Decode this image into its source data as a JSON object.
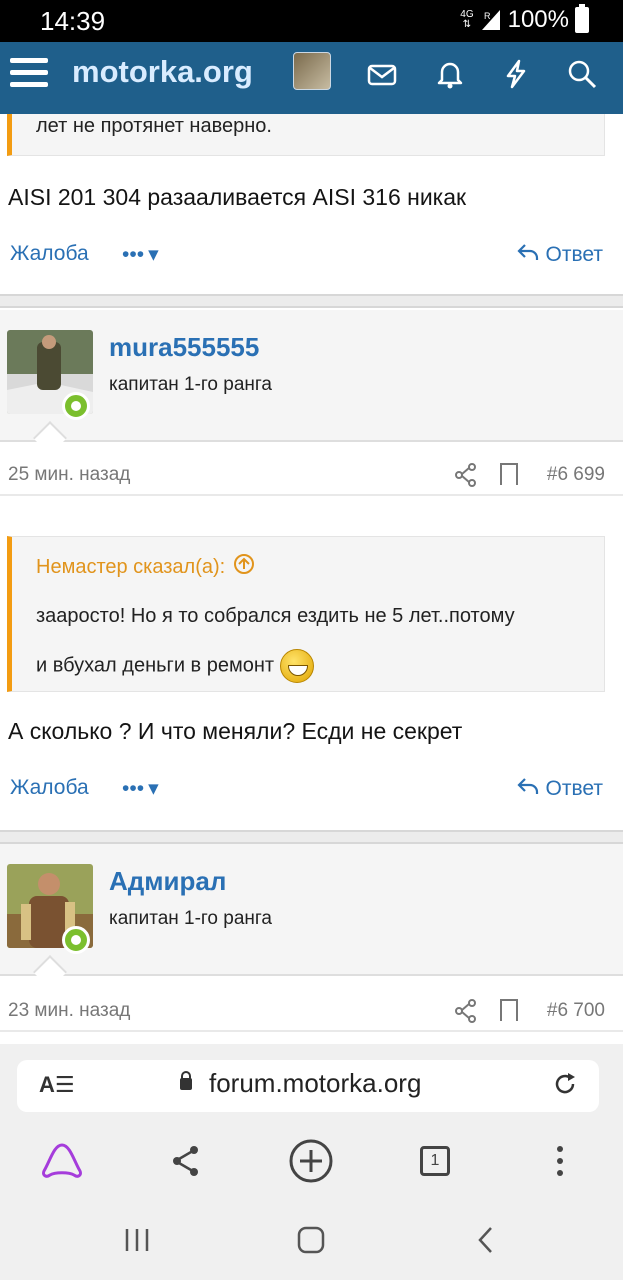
{
  "statusbar": {
    "time": "14:39",
    "network": "4G",
    "signal_label": "R",
    "battery": "100%"
  },
  "appbar": {
    "brand": "motorka.org",
    "icons": [
      "menu-icon",
      "envelope-icon",
      "bell-icon",
      "lightning-icon",
      "search-icon"
    ]
  },
  "post1": {
    "quote_text": "лет не протянет наверно.",
    "body": "AISI 201 304 разааливается AISI 316 никак",
    "complain": "Жалоба",
    "more": "•••",
    "reply": "Ответ"
  },
  "post2": {
    "username": "mura555555",
    "rank": "капитан 1-го ранга",
    "ago": "25 мин. назад",
    "number": "#6 699",
    "quote_author": "Немастер сказал(а):",
    "quote_line1": "заaросто! Но я то собрался ездить не 5 лет..потому",
    "quote_line2": "и вбухал деньги в ремонт",
    "body": "А сколько ? И что меняли? Есди не секрет",
    "complain": "Жалоба",
    "more": "•••",
    "reply": "Ответ"
  },
  "post3": {
    "username": "Адмирал",
    "rank": "капитан 1-го ранга",
    "ago": "23 мин. назад",
    "number": "#6 700"
  },
  "browser": {
    "read_mode": "A☰",
    "url": "forum.motorka.org",
    "tabs_count": "1"
  },
  "colors": {
    "appbar": "#1f5f8b",
    "link": "#2a70b4",
    "quote_accent": "#f39c12",
    "online": "#7bbf2d"
  }
}
